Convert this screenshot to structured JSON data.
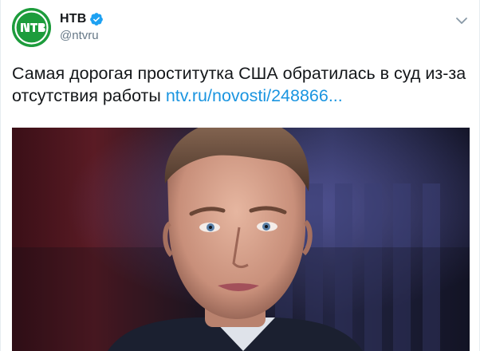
{
  "tweet": {
    "display_name": "НТВ",
    "handle": "@ntvru",
    "text_main": "Самая дорогая проститутка США обратилась в суд из-за отсутствия работы",
    "link_text": "ntv.ru/novosti/248866..."
  },
  "icons": {
    "avatar": "ntv-logo",
    "verified": "verified-badge-icon",
    "menu": "chevron-down-icon"
  },
  "colors": {
    "brand_green": "#1d9c3c",
    "verified_blue": "#1da1f2",
    "link_blue": "#1b95e0",
    "text": "#14171a",
    "muted": "#657786"
  }
}
